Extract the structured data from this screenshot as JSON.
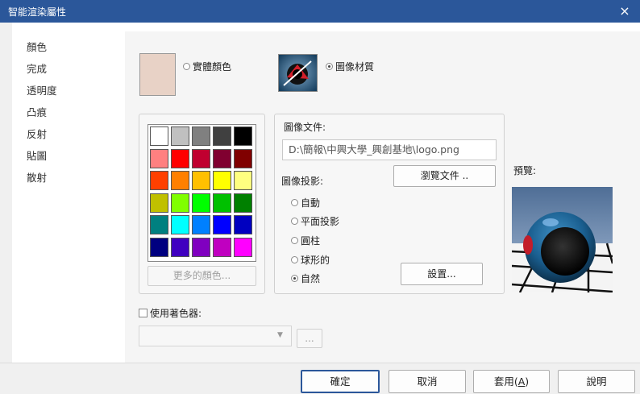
{
  "window": {
    "title": "智能渲染屬性",
    "close_glyph": "×"
  },
  "sidebar": {
    "items": [
      "顏色",
      "完成",
      "透明度",
      "凸痕",
      "反射",
      "貼圖",
      "散射"
    ]
  },
  "color_source": {
    "solid_label": "實體顏色",
    "image_label": "圖像材質",
    "selected": "image",
    "current_color": "#e8d2c6"
  },
  "palette": {
    "colors": [
      [
        "#ffffff",
        "#c0c0c0",
        "#808080",
        "#404040",
        "#000000"
      ],
      [
        "#ff8080",
        "#ff0000",
        "#c00030",
        "#800030",
        "#800000"
      ],
      [
        "#ff4000",
        "#ff8000",
        "#ffc000",
        "#ffff00",
        "#ffff80"
      ],
      [
        "#c0c000",
        "#80ff00",
        "#00ff00",
        "#00c000",
        "#008000"
      ],
      [
        "#008080",
        "#00ffff",
        "#0080ff",
        "#0000ff",
        "#0000c0"
      ],
      [
        "#000080",
        "#4000c0",
        "#8000c0",
        "#c000c0",
        "#ff00ff"
      ]
    ],
    "more_colors_label": "更多的顏色..."
  },
  "image_settings": {
    "file_label": "圖像文件:",
    "file_path": "D:\\簡報\\中興大學_興創基地\\logo.png",
    "browse_label": "瀏覽文件 ..",
    "projection_label": "圖像投影:",
    "projection_options": [
      "自動",
      "平面投影",
      "圓柱",
      "球形的",
      "自然"
    ],
    "selected_projection": "自然",
    "settings_label": "設置..."
  },
  "preview": {
    "label": "預覽:"
  },
  "shader": {
    "checkbox_label": "使用著色器:",
    "dropdown_value": "",
    "more_label": "..."
  },
  "footer": {
    "ok": "確定",
    "cancel": "取消",
    "apply_prefix": "套用(",
    "apply_key": "A",
    "apply_suffix": ")",
    "help": "說明"
  },
  "colors": {
    "titlebar": "#2b579a",
    "accent": "#2b579a"
  }
}
